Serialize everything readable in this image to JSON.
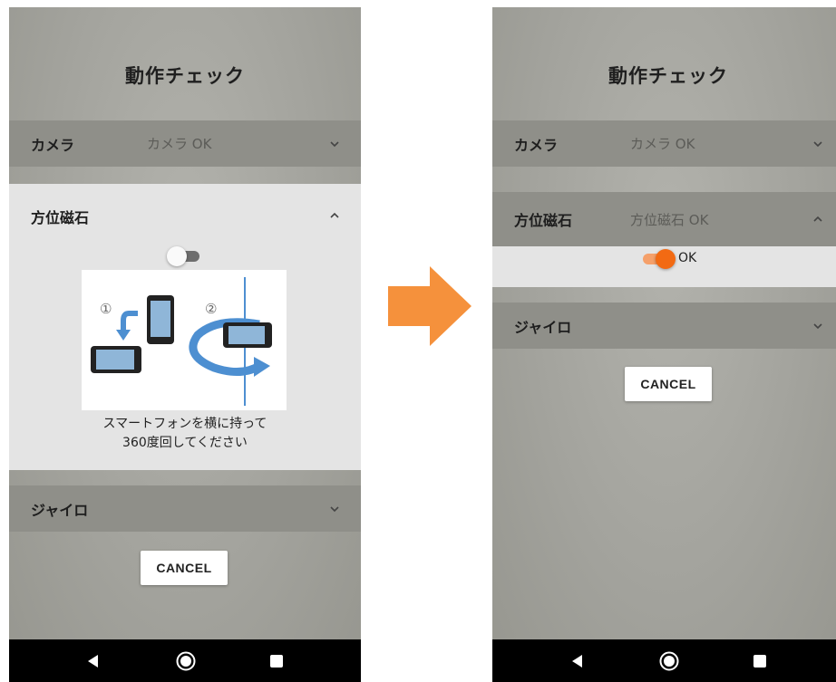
{
  "left_screen": {
    "title": "動作チェック",
    "camera": {
      "label": "カメラ",
      "status": "カメラ OK"
    },
    "compass": {
      "label": "方位磁石",
      "toggle_on": false,
      "instruction_line1": "スマートフォンを横に持って",
      "instruction_line2": "360度回してください",
      "step1": "①",
      "step2": "②"
    },
    "gyro": {
      "label": "ジャイロ"
    },
    "cancel_label": "CANCEL"
  },
  "right_screen": {
    "title": "動作チェック",
    "camera": {
      "label": "カメラ",
      "status": "カメラ OK"
    },
    "compass": {
      "label": "方位磁石",
      "status": "方位磁石 OK",
      "toggle_on": true,
      "toggle_label": "OK"
    },
    "gyro": {
      "label": "ジャイロ"
    },
    "cancel_label": "CANCEL"
  },
  "colors": {
    "toggle_on": "#f26a13",
    "toggle_on_track": "#f5a06a",
    "toggle_off_knob": "#fafafa",
    "toggle_off_track": "#6e6e6e",
    "transition_arrow": "#f5913c",
    "illustration_blue": "#4d8fd1"
  }
}
